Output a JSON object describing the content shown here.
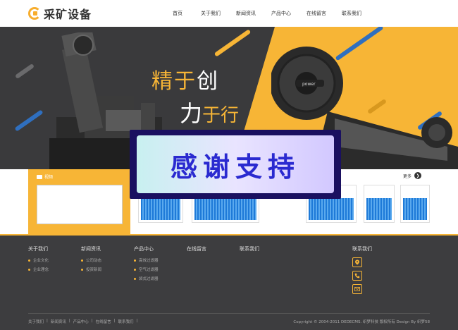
{
  "brand": {
    "name": "采矿设备",
    "accent": "#f7b536"
  },
  "nav": [
    "首页",
    "关于我们",
    "新闻资讯",
    "产品中心",
    "在线留言",
    "联系我们"
  ],
  "banner": {
    "slogan_line1_white": "精于",
    "slogan_line1_accent": "创",
    "slogan_line2_white": "力",
    "slogan_line2_accent": "于行",
    "machine_brand": "power"
  },
  "overlay": {
    "text": "感谢支持"
  },
  "products": {
    "video_label": "视频",
    "more_label": "更多",
    "thumb_count": 5
  },
  "footer": {
    "columns": [
      {
        "title": "关于我们",
        "items": [
          "企业文化",
          "企业理念"
        ]
      },
      {
        "title": "新闻资讯",
        "items": [
          "公司动态",
          "投资新闻"
        ]
      },
      {
        "title": "产品中心",
        "items": [
          "高效过滤器",
          "空气过滤器",
          "袋式过滤器"
        ]
      },
      {
        "title": "在线留言",
        "items": []
      },
      {
        "title": "联系我们",
        "items": []
      },
      {
        "title": "联系我们",
        "items": []
      }
    ],
    "contact_icons": [
      "location-icon",
      "phone-icon",
      "mail-icon"
    ],
    "bottom_links": [
      "关于我们",
      "新闻资讯",
      "产品中心",
      "在线留言",
      "联系我们"
    ],
    "copyright": "Copyright © 2004-2011 DEDECMS. 织梦科技 版权所有  Design By 织梦58"
  }
}
